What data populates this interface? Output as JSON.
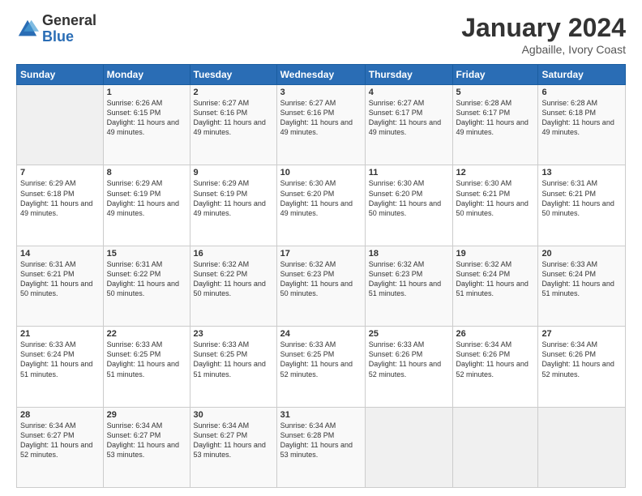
{
  "header": {
    "logo": {
      "general": "General",
      "blue": "Blue"
    },
    "title": "January 2024",
    "location": "Agbaille, Ivory Coast"
  },
  "days_of_week": [
    "Sunday",
    "Monday",
    "Tuesday",
    "Wednesday",
    "Thursday",
    "Friday",
    "Saturday"
  ],
  "weeks": [
    [
      {
        "num": "",
        "empty": true
      },
      {
        "num": "1",
        "sunrise": "6:26 AM",
        "sunset": "6:15 PM",
        "daylight": "11 hours and 49 minutes."
      },
      {
        "num": "2",
        "sunrise": "6:27 AM",
        "sunset": "6:16 PM",
        "daylight": "11 hours and 49 minutes."
      },
      {
        "num": "3",
        "sunrise": "6:27 AM",
        "sunset": "6:16 PM",
        "daylight": "11 hours and 49 minutes."
      },
      {
        "num": "4",
        "sunrise": "6:27 AM",
        "sunset": "6:17 PM",
        "daylight": "11 hours and 49 minutes."
      },
      {
        "num": "5",
        "sunrise": "6:28 AM",
        "sunset": "6:17 PM",
        "daylight": "11 hours and 49 minutes."
      },
      {
        "num": "6",
        "sunrise": "6:28 AM",
        "sunset": "6:18 PM",
        "daylight": "11 hours and 49 minutes."
      }
    ],
    [
      {
        "num": "7",
        "sunrise": "6:29 AM",
        "sunset": "6:18 PM",
        "daylight": "11 hours and 49 minutes."
      },
      {
        "num": "8",
        "sunrise": "6:29 AM",
        "sunset": "6:19 PM",
        "daylight": "11 hours and 49 minutes."
      },
      {
        "num": "9",
        "sunrise": "6:29 AM",
        "sunset": "6:19 PM",
        "daylight": "11 hours and 49 minutes."
      },
      {
        "num": "10",
        "sunrise": "6:30 AM",
        "sunset": "6:20 PM",
        "daylight": "11 hours and 49 minutes."
      },
      {
        "num": "11",
        "sunrise": "6:30 AM",
        "sunset": "6:20 PM",
        "daylight": "11 hours and 50 minutes."
      },
      {
        "num": "12",
        "sunrise": "6:30 AM",
        "sunset": "6:21 PM",
        "daylight": "11 hours and 50 minutes."
      },
      {
        "num": "13",
        "sunrise": "6:31 AM",
        "sunset": "6:21 PM",
        "daylight": "11 hours and 50 minutes."
      }
    ],
    [
      {
        "num": "14",
        "sunrise": "6:31 AM",
        "sunset": "6:21 PM",
        "daylight": "11 hours and 50 minutes."
      },
      {
        "num": "15",
        "sunrise": "6:31 AM",
        "sunset": "6:22 PM",
        "daylight": "11 hours and 50 minutes."
      },
      {
        "num": "16",
        "sunrise": "6:32 AM",
        "sunset": "6:22 PM",
        "daylight": "11 hours and 50 minutes."
      },
      {
        "num": "17",
        "sunrise": "6:32 AM",
        "sunset": "6:23 PM",
        "daylight": "11 hours and 50 minutes."
      },
      {
        "num": "18",
        "sunrise": "6:32 AM",
        "sunset": "6:23 PM",
        "daylight": "11 hours and 51 minutes."
      },
      {
        "num": "19",
        "sunrise": "6:32 AM",
        "sunset": "6:24 PM",
        "daylight": "11 hours and 51 minutes."
      },
      {
        "num": "20",
        "sunrise": "6:33 AM",
        "sunset": "6:24 PM",
        "daylight": "11 hours and 51 minutes."
      }
    ],
    [
      {
        "num": "21",
        "sunrise": "6:33 AM",
        "sunset": "6:24 PM",
        "daylight": "11 hours and 51 minutes."
      },
      {
        "num": "22",
        "sunrise": "6:33 AM",
        "sunset": "6:25 PM",
        "daylight": "11 hours and 51 minutes."
      },
      {
        "num": "23",
        "sunrise": "6:33 AM",
        "sunset": "6:25 PM",
        "daylight": "11 hours and 51 minutes."
      },
      {
        "num": "24",
        "sunrise": "6:33 AM",
        "sunset": "6:25 PM",
        "daylight": "11 hours and 52 minutes."
      },
      {
        "num": "25",
        "sunrise": "6:33 AM",
        "sunset": "6:26 PM",
        "daylight": "11 hours and 52 minutes."
      },
      {
        "num": "26",
        "sunrise": "6:34 AM",
        "sunset": "6:26 PM",
        "daylight": "11 hours and 52 minutes."
      },
      {
        "num": "27",
        "sunrise": "6:34 AM",
        "sunset": "6:26 PM",
        "daylight": "11 hours and 52 minutes."
      }
    ],
    [
      {
        "num": "28",
        "sunrise": "6:34 AM",
        "sunset": "6:27 PM",
        "daylight": "11 hours and 52 minutes."
      },
      {
        "num": "29",
        "sunrise": "6:34 AM",
        "sunset": "6:27 PM",
        "daylight": "11 hours and 53 minutes."
      },
      {
        "num": "30",
        "sunrise": "6:34 AM",
        "sunset": "6:27 PM",
        "daylight": "11 hours and 53 minutes."
      },
      {
        "num": "31",
        "sunrise": "6:34 AM",
        "sunset": "6:28 PM",
        "daylight": "11 hours and 53 minutes."
      },
      {
        "num": "",
        "empty": true
      },
      {
        "num": "",
        "empty": true
      },
      {
        "num": "",
        "empty": true
      }
    ]
  ]
}
